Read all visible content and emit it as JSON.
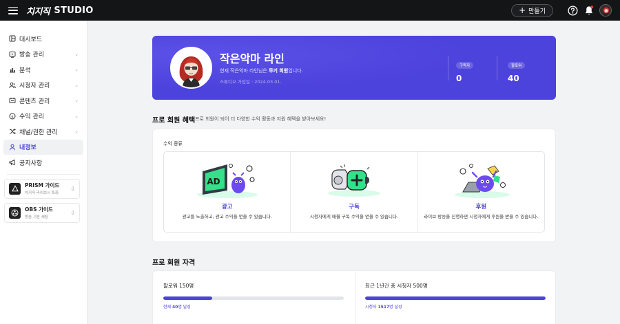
{
  "app": {
    "logo_mark": "치지직",
    "logo_studio": "STUDIO"
  },
  "topbar": {
    "create_label": "만들기",
    "icons": [
      "menu-icon",
      "plus-icon",
      "help-icon",
      "bell-icon",
      "user-avatar"
    ]
  },
  "sidebar": {
    "items": [
      {
        "label": "대시보드",
        "icon": "dashboard-icon",
        "chevron": false
      },
      {
        "label": "방송 관리",
        "icon": "broadcast-icon",
        "chevron": true
      },
      {
        "label": "분석",
        "icon": "analytics-icon",
        "chevron": true
      },
      {
        "label": "시청자 관리",
        "icon": "viewers-icon",
        "chevron": true
      },
      {
        "label": "콘텐츠 관리",
        "icon": "content-icon",
        "chevron": true
      },
      {
        "label": "수익 관리",
        "icon": "revenue-icon",
        "chevron": true
      },
      {
        "label": "채널/권한 관리",
        "icon": "shuffle-icon",
        "chevron": true
      },
      {
        "label": "내정보",
        "icon": "user-icon",
        "chevron": false,
        "active": true
      },
      {
        "label": "공지사항",
        "icon": "megaphone-icon",
        "chevron": false
      }
    ],
    "guides": [
      {
        "title": "PRISM 가이드",
        "sub": "치지직 라이브시 특화",
        "icon": "prism-icon"
      },
      {
        "title": "OBS 가이드",
        "sub": "방송 기본 세팅",
        "icon": "obs-icon"
      }
    ]
  },
  "profile": {
    "name": "작은악마 라인",
    "desc_prefix": "현재 작은악마 라인님은 ",
    "desc_bold": "루키 회원",
    "desc_suffix": "입니다.",
    "joined": "스튜디오 가입일 : 2024.03.01.",
    "stats": [
      {
        "label": "구독자",
        "value": "0"
      },
      {
        "label": "팔로워",
        "value": "40"
      }
    ],
    "accent": "#4c42dc"
  },
  "benefits": {
    "title": "프로 회원 혜택",
    "subtitle": "프로 회원이 되어 더 다양한 수익 활동과 지원 혜택을 받아보세요!",
    "revenue_label": "수익 종류",
    "items": [
      {
        "title": "광고",
        "desc": "광고를 노출하고, 광고 수익을 얻을 수 있습니다."
      },
      {
        "title": "구독",
        "desc": "시청자에게 매월 구독 수익을 얻을 수 있습니다."
      },
      {
        "title": "후원",
        "desc": "라이브 방송을 진행하면 시청자에게 후원을 받을 수 있습니다."
      }
    ]
  },
  "qualification": {
    "title": "프로 회원 자격",
    "items": [
      {
        "title": "팔로워 150명",
        "progress": 0.27,
        "note_prefix": "현재 ",
        "note_bold": "40",
        "note_suffix": "명 달성"
      },
      {
        "title": "최근 1년간 총 시청자 500명",
        "progress": 1.0,
        "note_prefix": "시청자 ",
        "note_bold": "1517",
        "note_suffix": "명 달성"
      }
    ]
  },
  "colors": {
    "brand": "#4b44d8",
    "topbar": "#141517",
    "accent_green": "#34e08a"
  }
}
